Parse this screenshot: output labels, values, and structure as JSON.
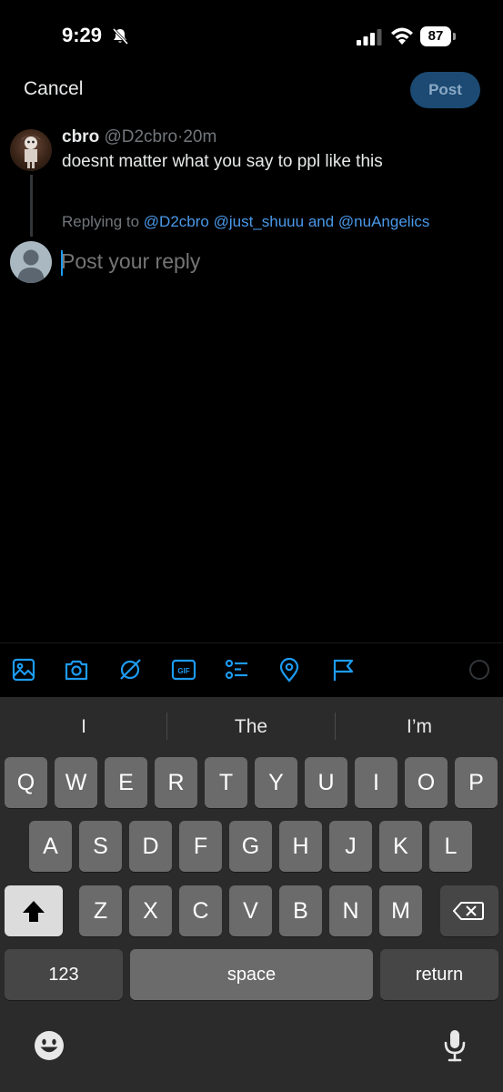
{
  "status_bar": {
    "time": "9:29",
    "battery": "87"
  },
  "header": {
    "cancel_label": "Cancel",
    "post_label": "Post"
  },
  "tweet": {
    "name": "cbro",
    "handle": "@D2cbro",
    "separator": "·",
    "age": "20m",
    "text": "doesnt matter what you say to ppl like this"
  },
  "reply": {
    "prefix": "Replying to ",
    "mention1": "@D2cbro",
    "mention2": "@just_shuuu",
    "conj": "and",
    "mention3": "@nuAngelics",
    "placeholder": "Post your reply"
  },
  "toolbar": {
    "icons": [
      "image-icon",
      "camera-icon",
      "grok-icon",
      "gif-icon",
      "poll-icon",
      "location-icon",
      "flag-icon"
    ],
    "accent": "#1d9bf0"
  },
  "keyboard": {
    "suggestions": [
      "I",
      "The",
      "I’m"
    ],
    "row1": [
      "Q",
      "W",
      "E",
      "R",
      "T",
      "Y",
      "U",
      "I",
      "O",
      "P"
    ],
    "row2": [
      "A",
      "S",
      "D",
      "F",
      "G",
      "H",
      "J",
      "K",
      "L"
    ],
    "row3": [
      "Z",
      "X",
      "C",
      "V",
      "B",
      "N",
      "M"
    ],
    "numbers_label": "123",
    "space_label": "space",
    "return_label": "return"
  }
}
